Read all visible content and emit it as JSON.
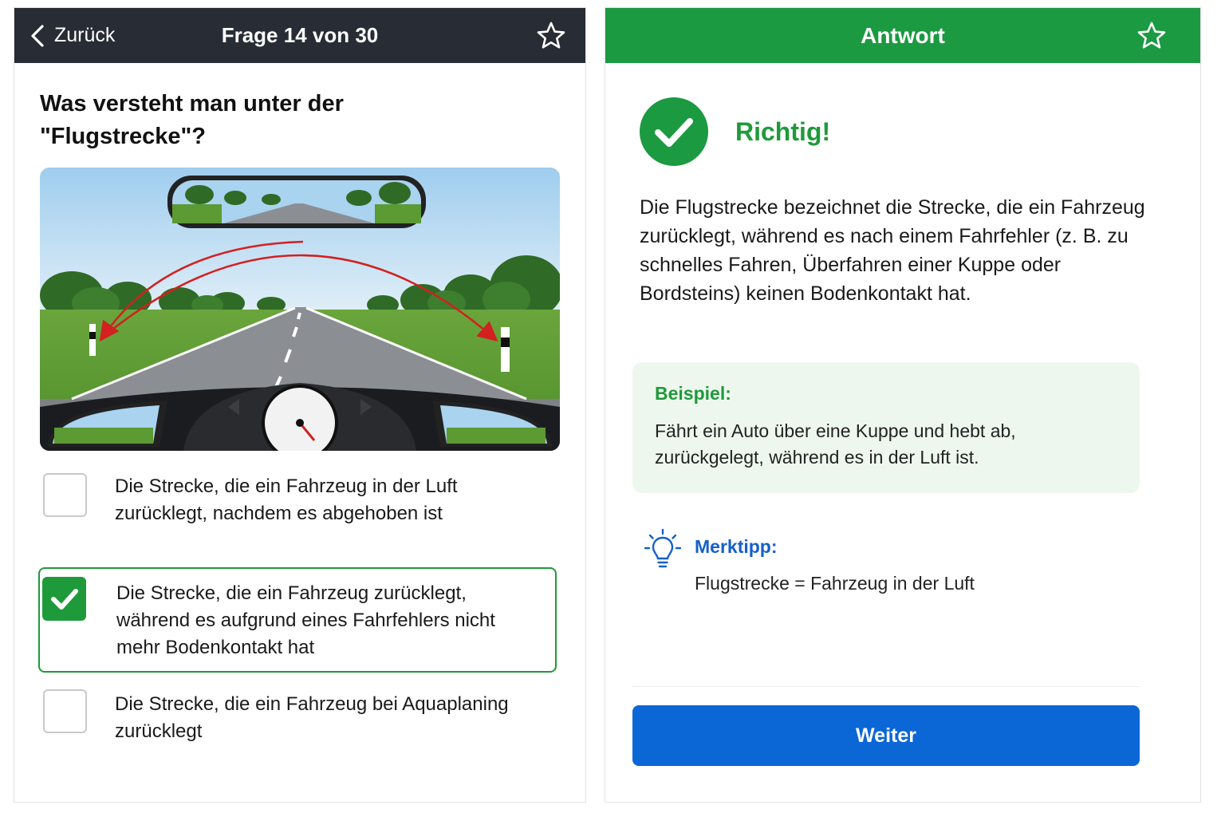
{
  "question_panel": {
    "back_label": "Zurück",
    "counter": "Frage 14 von 30",
    "question": "Was versteht man unter der \"Flugstrecke\"?",
    "image_icon": "road-scene-illustration",
    "options": [
      {
        "text": "Die Strecke, die ein Fahrzeug in der Luft zurücklegt, nachdem es abgehoben ist",
        "selected": false
      },
      {
        "text": "Die Strecke, die ein Fahrzeug zurücklegt, während es aufgrund eines Fahrfehlers nicht mehr Bodenkontakt hat",
        "selected": true
      },
      {
        "text": "Die Strecke, die ein Fahrzeug bei Aquaplaning zurücklegt",
        "selected": false
      }
    ]
  },
  "answer_panel": {
    "title": "Antwort",
    "result": "Richtig!",
    "explanation": "Die Flugstrecke bezeichnet die Strecke, die ein Fahrzeug zurücklegt, während es nach einem Fahrfehler (z. B. zu schnelles Fahren, Überfahren einer Kuppe oder Bordsteins) keinen Bodenkontakt hat.",
    "example": {
      "title": "Beispiel:",
      "text": "Fährt ein Auto über eine Kuppe und hebt ab, zurückgelegt, während es in der Luft ist."
    },
    "tip": {
      "title": "Merktipp:",
      "text": "Flugstrecke = Fahrzeug in der Luft",
      "icon": "lightbulb-icon"
    },
    "next_label": "Weiter"
  },
  "colors": {
    "header_dark": "#282c34",
    "header_green": "#1b9a41",
    "accent_green": "#1f9a3a",
    "accent_blue": "#0b66d6",
    "tip_blue": "#1560c9",
    "example_bg": "#eef7ee"
  }
}
